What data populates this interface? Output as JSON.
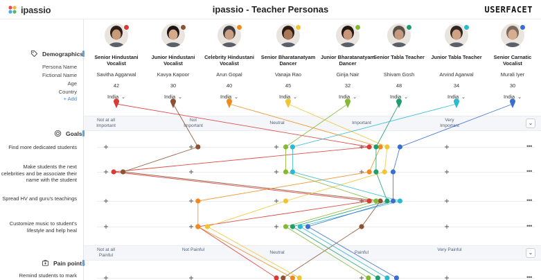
{
  "app": {
    "logo_text": "ipassio",
    "title": "ipassio - Teacher Personas",
    "brand": "USERFACET"
  },
  "sidebar": {
    "demographics_label": "Demographics",
    "field_labels": [
      "Persona Name",
      "Fictional Name",
      "Age",
      "Country"
    ],
    "add_label": "+ Add",
    "goals_label": "Goals",
    "pain_points_label": "Pain points"
  },
  "personas": [
    {
      "role": "Senior Hindustani Vocalist",
      "name": "Savitha Aggarwal",
      "age": "42",
      "country": "India",
      "color": "#d93a34",
      "skin": "#c99a78",
      "hair": "#2b1d17"
    },
    {
      "role": "Junior Hindustani Vocalist",
      "name": "Kavya Kapoor",
      "age": "30",
      "country": "India",
      "color": "#8c5232",
      "skin": "#d6a98a",
      "hair": "#1b1513"
    },
    {
      "role": "Celebrity Hindustani Vocalist",
      "name": "Arun Gopal",
      "age": "40",
      "country": "India",
      "color": "#ef8a1e",
      "skin": "#caa184",
      "hair": "#3a3a3a"
    },
    {
      "role": "Senior Bharatanatyam Dancer",
      "name": "Vanaja Rao",
      "age": "45",
      "country": "India",
      "color": "#f0c433",
      "skin": "#a9785b",
      "hair": "#2a1a12"
    },
    {
      "role": "Junior Bharatanatyam Dancer",
      "name": "Girija Nair",
      "age": "32",
      "country": "India",
      "color": "#86b832",
      "skin": "#c8977a",
      "hair": "#1f1612"
    },
    {
      "role": "Senior Tabla Teacher",
      "name": "Shivam Gosh",
      "age": "48",
      "country": "India",
      "color": "#1f9e6d",
      "skin": "#c69a80",
      "hair": "#5a5048"
    },
    {
      "role": "Junior Tabla Teacher",
      "name": "Arvind Agarwal",
      "age": "34",
      "country": "India",
      "color": "#2bb9d0",
      "skin": "#cfa285",
      "hair": "#2e2420"
    },
    {
      "role": "Senior Carnatic Vocalist",
      "name": "Murali Iyer",
      "age": "30",
      "country": "India",
      "color": "#3a6fd0",
      "skin": "#d7ad92",
      "hair": "#7a6a5c"
    }
  ],
  "importance_scale": [
    "Not at all Important",
    "Not Important",
    "Neutral",
    "Important",
    "Very Important"
  ],
  "painful_scale": [
    "Not at all Painful",
    "Not Painful",
    "Neutral",
    "Painful",
    "Very Painful"
  ],
  "goals": [
    "Find more dedicated students",
    "Make students the next celebrities and be associate their name with the student",
    "Spread HV and guru's teachings",
    "Customize music to student's lifestyle and help heal"
  ],
  "pain_points": [
    "Remind students to mark"
  ],
  "chart_data": {
    "type": "parallel-ratings",
    "series_order": [
      "Savitha Aggarwal",
      "Kavya Kapoor",
      "Arun Gopal",
      "Vanaja Rao",
      "Girija Nair",
      "Shivam Gosh",
      "Arvind Agarwal",
      "Murali Iyer"
    ],
    "goal_ratings": [
      [
        4.09,
        2.08,
        4.22,
        4.3,
        3.11,
        4.17,
        3.19,
        4.45
      ],
      [
        1.09,
        1.2,
        4.09,
        4.27,
        3.11,
        4.17,
        3.19,
        4.37
      ],
      [
        4.09,
        4.22,
        2.08,
        3.11,
        4.17,
        4.3,
        4.45,
        4.37
      ],
      [
        2.08,
        4.0,
        2.08,
        2.19,
        3.11,
        3.19,
        3.28,
        3.37
      ]
    ],
    "pain_ratings": [
      [
        3.0,
        3.08,
        3.19,
        3.27,
        4.08,
        4.19,
        4.3,
        4.41
      ]
    ]
  }
}
